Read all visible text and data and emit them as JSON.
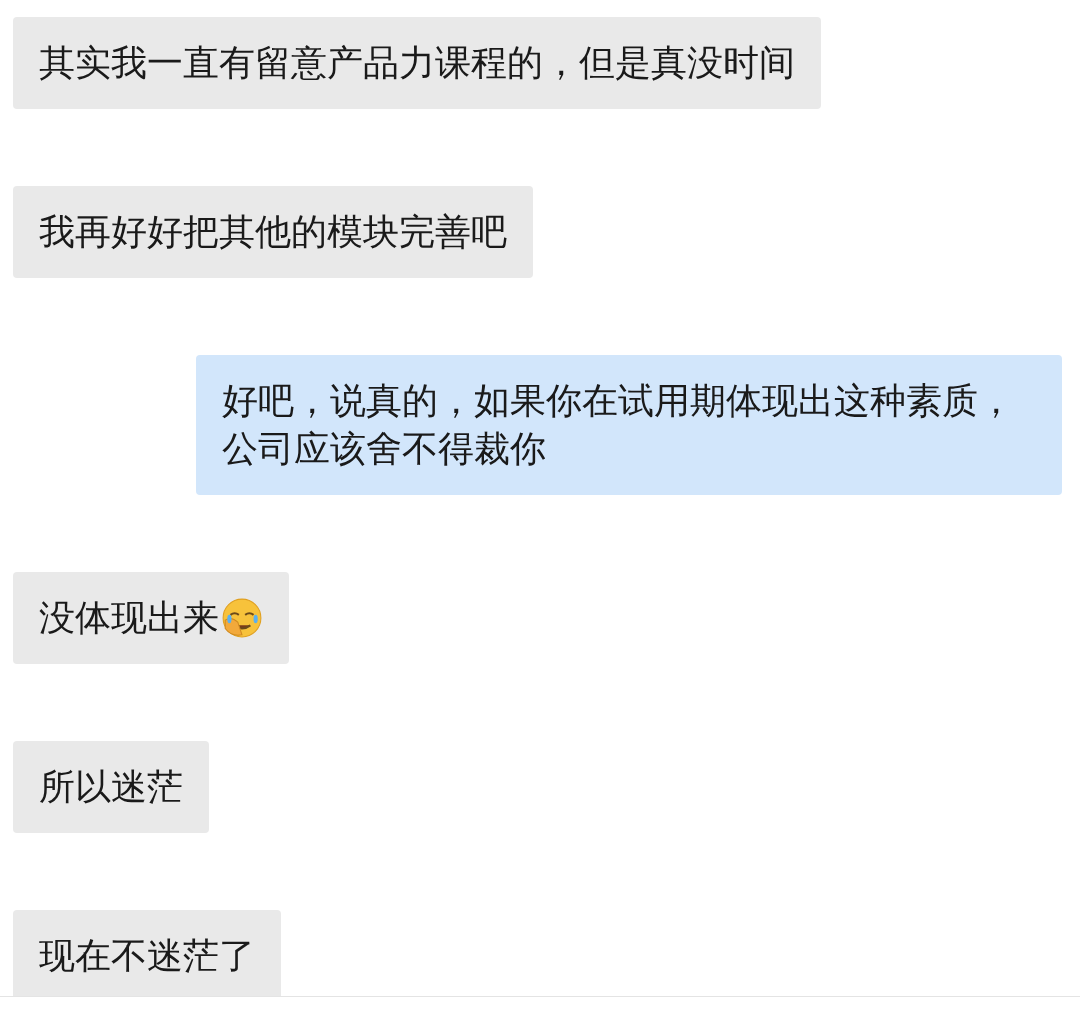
{
  "messages": [
    {
      "kind": "received",
      "text": "其实我一直有留意产品力课程的，但是真没时间",
      "emoji": false
    },
    {
      "kind": "received",
      "text": "我再好好把其他的模块完善吧",
      "emoji": false
    },
    {
      "kind": "sent",
      "text": "好吧，说真的，如果你在试用期体现出这种素质，公司应该舍不得裁你",
      "emoji": false
    },
    {
      "kind": "received",
      "text": "没体现出来",
      "emoji": true
    },
    {
      "kind": "received",
      "text": "所以迷茫",
      "emoji": false
    },
    {
      "kind": "received",
      "text": "现在不迷茫了",
      "emoji": false
    }
  ]
}
